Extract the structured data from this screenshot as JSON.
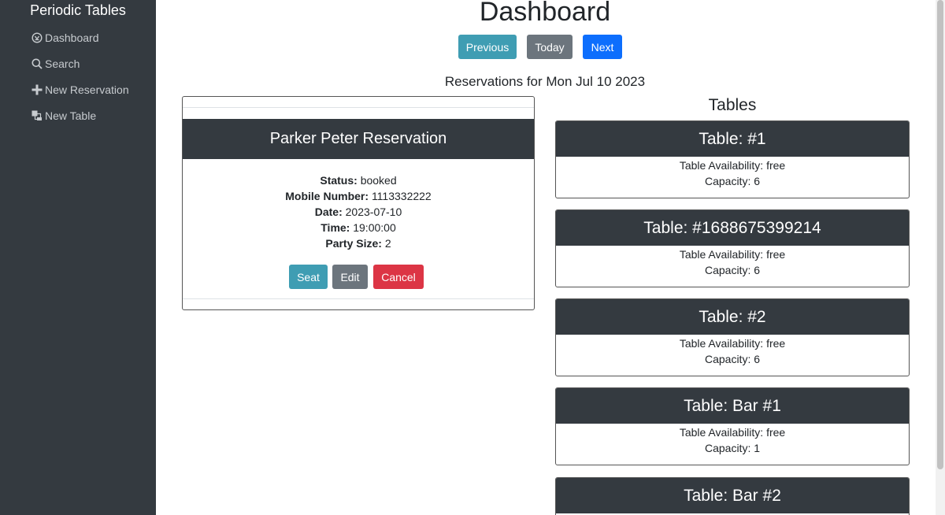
{
  "sidebar": {
    "brand": "Periodic Tables",
    "items": [
      {
        "label": "Dashboard",
        "icon": "dashboard-icon"
      },
      {
        "label": "Search",
        "icon": "search-icon"
      },
      {
        "label": "New Reservation",
        "icon": "plus-icon"
      },
      {
        "label": "New Table",
        "icon": "layers-icon"
      }
    ]
  },
  "header": {
    "title": "Dashboard",
    "previous_label": "Previous",
    "today_label": "Today",
    "next_label": "Next",
    "reservations_heading": "Reservations for Mon Jul 10 2023"
  },
  "reservation": {
    "title": "Parker Peter Reservation",
    "status_label": "Status:",
    "status": "booked",
    "mobile_label": "Mobile Number:",
    "mobile": "1113332222",
    "date_label": "Date:",
    "date": "2023-07-10",
    "time_label": "Time:",
    "time": "19:00:00",
    "party_label": "Party Size:",
    "party": "2",
    "seat_label": "Seat",
    "edit_label": "Edit",
    "cancel_label": "Cancel"
  },
  "tables": {
    "heading": "Tables",
    "items": [
      {
        "title": "Table: #1",
        "availability": "Table Availability: free",
        "capacity": "Capacity: 6"
      },
      {
        "title": "Table: #1688675399214",
        "availability": "Table Availability: free",
        "capacity": "Capacity: 6"
      },
      {
        "title": "Table: #2",
        "availability": "Table Availability: free",
        "capacity": "Capacity: 6"
      },
      {
        "title": "Table: Bar #1",
        "availability": "Table Availability: free",
        "capacity": "Capacity: 1"
      },
      {
        "title": "Table: Bar #2"
      }
    ]
  },
  "colors": {
    "sidebar_bg": "#343a40",
    "info": "#3f9db3",
    "secondary": "#6c757d",
    "primary": "#0d6efd",
    "danger": "#dc3545"
  }
}
